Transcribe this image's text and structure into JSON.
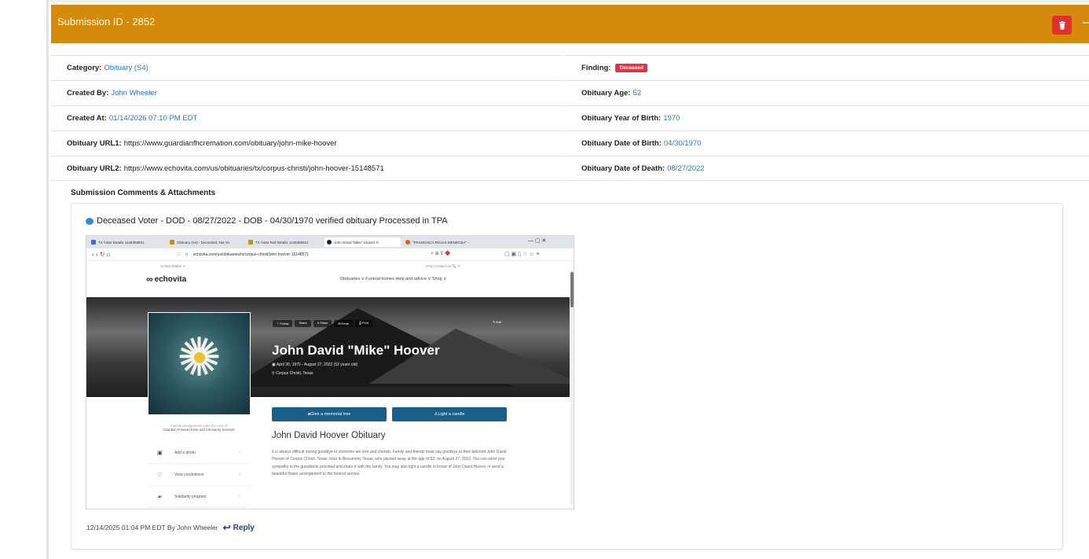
{
  "header": {
    "title": "Submission ID - 2852",
    "collapse_glyph": "—",
    "accent_color": "#d68a0b"
  },
  "details": {
    "category_label": "Category:",
    "category_value": "Obituary (S4)",
    "created_by_label": "Created By:",
    "created_by_value": "John Wheeler",
    "created_at_label": "Created At:",
    "created_at_value": "01/14/2026 07:10 PM EDT",
    "url1_label": "Obituary URL1:",
    "url1_value": "https://www.guardianfhcremation.com/obituary/john-mike-hoover",
    "url2_label": "Obituary URL2:",
    "url2_value": "https://www.echovita.com/us/obituaries/tx/corpus-christi/john-hoover-15148571",
    "finding_label": "Finding:",
    "finding_badge": "Deceased",
    "age_label": "Obituary Age:",
    "age_value": "52",
    "yob_label": "Obituary Year of Birth:",
    "yob_value": "1970",
    "dob_label": "Obituary Date of Birth:",
    "dob_value": "04/30/1970",
    "dod_label": "Obituary Date of Death:",
    "dod_value": "08/27/2022"
  },
  "comments": {
    "section_title": "Submission Comments & Attachments",
    "comment_text": "Deceased Voter - DOD - 08/27/2022 - DOB - 04/30/1970 verified obituary Processed in TPA",
    "footer_meta": "12/14/2025 01:04 PM EDT By John Wheeler",
    "reply_label": "Reply"
  },
  "attachment": {
    "browser_tabs": [
      "TX Voter Details 1148358921",
      "Obituary (S4) - Deceased, Not Vo",
      "TX Voter Roll Details 1148358921",
      "John David \"Mike\" Hoover O",
      "\"FRANCISCA ROJAS MENDOZA\" -"
    ],
    "window_controls": "—   ▢   ✕",
    "url": "echovita.com/us/obituaries/tx/corpus-christi/john-hoover-15148571",
    "country": "United States ∨",
    "faq": "FAQ   Contact us   🔍   ⓪",
    "logo_text": "echovita",
    "nav": "Obituaries ∨    Funeral homes    Help and advice ∨    Shop ∨",
    "share_buttons": [
      "♡ Follow",
      "Share",
      "X Share",
      "✉ Email",
      "⎙ Print"
    ],
    "edit_label": "✎ Edit",
    "deceased_name": "John David \"Mike\" Hoover",
    "dates": "April 30, 1970 - August 27, 2022 (52 years old)",
    "place": "Corpus Christi, Texas",
    "funeral_note_line1": "Funeral arrangement under the care of",
    "funeral_note_line2": "Guardian Funeral Home and Crematory Services",
    "actions": [
      "Add a photo",
      "View condolence",
      "Solidarity program"
    ],
    "btn_tree": "Give a memorial tree",
    "btn_candle": "Light a candle",
    "obit_title": "John David Hoover Obituary",
    "obit_body": "It is always difficult saying goodbye to someone we love and cherish. Family and friends must say goodbye to their beloved John David Hoover of Corpus Christi, Texas, born in Beaumont, Texas, who passed away at the age of 52, on August 27, 2022. You can send your sympathy in the guestbook provided and share it with the family. You may also light a candle in honor of John David Hoover or send a beautiful flower arrangement to the funeral service."
  }
}
